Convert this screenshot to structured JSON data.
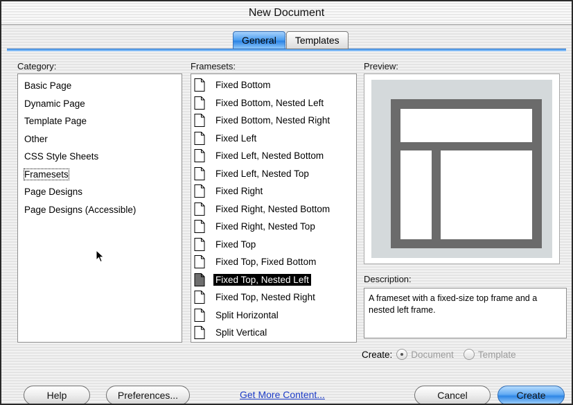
{
  "window": {
    "title": "New Document"
  },
  "tabs": [
    {
      "label": "General",
      "active": true
    },
    {
      "label": "Templates",
      "active": false
    }
  ],
  "labels": {
    "category": "Category:",
    "framesets": "Framesets:",
    "preview": "Preview:",
    "description": "Description:"
  },
  "categories": [
    "Basic Page",
    "Dynamic Page",
    "Template Page",
    "Other",
    "CSS Style Sheets",
    "Framesets",
    "Page Designs",
    "Page Designs (Accessible)"
  ],
  "selected_category": "Framesets",
  "framesets": [
    "Fixed Bottom",
    "Fixed Bottom, Nested Left",
    "Fixed Bottom, Nested Right",
    "Fixed Left",
    "Fixed Left, Nested Bottom",
    "Fixed Left, Nested Top",
    "Fixed Right",
    "Fixed Right, Nested Bottom",
    "Fixed Right, Nested Top",
    "Fixed Top",
    "Fixed Top, Fixed Bottom",
    "Fixed Top, Nested Left",
    "Fixed Top, Nested Right",
    "Split Horizontal",
    "Split Vertical"
  ],
  "selected_frameset": "Fixed Top, Nested Left",
  "description_text": "A frameset with a fixed-size top frame and a nested left frame.",
  "create": {
    "label": "Create:",
    "options": [
      {
        "label": "Document",
        "checked": true
      },
      {
        "label": "Template",
        "checked": false
      }
    ]
  },
  "buttons": {
    "help": "Help",
    "preferences": "Preferences...",
    "get_more": "Get More Content...",
    "cancel": "Cancel",
    "create": "Create"
  },
  "colors": {
    "accent": "#3a8ded",
    "selection": "#000000",
    "frame_gray": "#6b6b6b",
    "link": "#1d3cc7"
  },
  "icons": {
    "doc": "document-icon",
    "doc_selected": "document-filled-icon",
    "cursor": "mouse-pointer-icon"
  }
}
